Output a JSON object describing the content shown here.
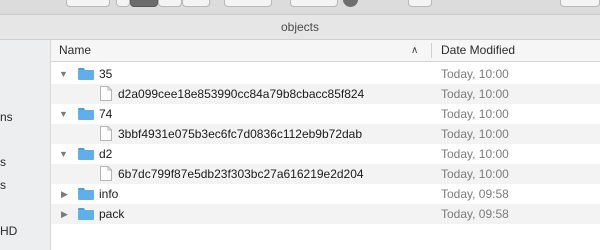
{
  "window": {
    "title": "objects"
  },
  "sidebar": {
    "labels": [
      "ns",
      "s",
      "s",
      "HD"
    ]
  },
  "columns": {
    "name": "Name",
    "date_modified": "Date Modified"
  },
  "rows": [
    {
      "name": "35",
      "kind": "folder",
      "expanded": true,
      "date": "Today, 10:00"
    },
    {
      "name": "d2a099cee18e853990cc84a79b8cbacc85f824",
      "kind": "file",
      "date": "Today, 10:00"
    },
    {
      "name": "74",
      "kind": "folder",
      "expanded": true,
      "date": "Today, 10:00"
    },
    {
      "name": "3bbf4931e075b3ec6fc7d0836c112eb9b72dab",
      "kind": "file",
      "date": "Today, 10:00"
    },
    {
      "name": "d2",
      "kind": "folder",
      "expanded": true,
      "date": "Today, 10:00"
    },
    {
      "name": "6b7dc799f87e5db23f303bc27a616219e2d204",
      "kind": "file",
      "date": "Today, 10:00"
    },
    {
      "name": "info",
      "kind": "folder",
      "expanded": false,
      "date": "Today, 09:58"
    },
    {
      "name": "pack",
      "kind": "folder",
      "expanded": false,
      "date": "Today, 09:58"
    }
  ],
  "colors": {
    "folder": "#5fb0ea",
    "folder_tab": "#4aa0de",
    "date_text": "#7c7c7c",
    "alt_row": "#f3f3f3"
  },
  "icons": {
    "expanded": "disclosure-open-icon",
    "collapsed": "disclosure-closed-icon",
    "sort": "sort-ascending-icon"
  }
}
